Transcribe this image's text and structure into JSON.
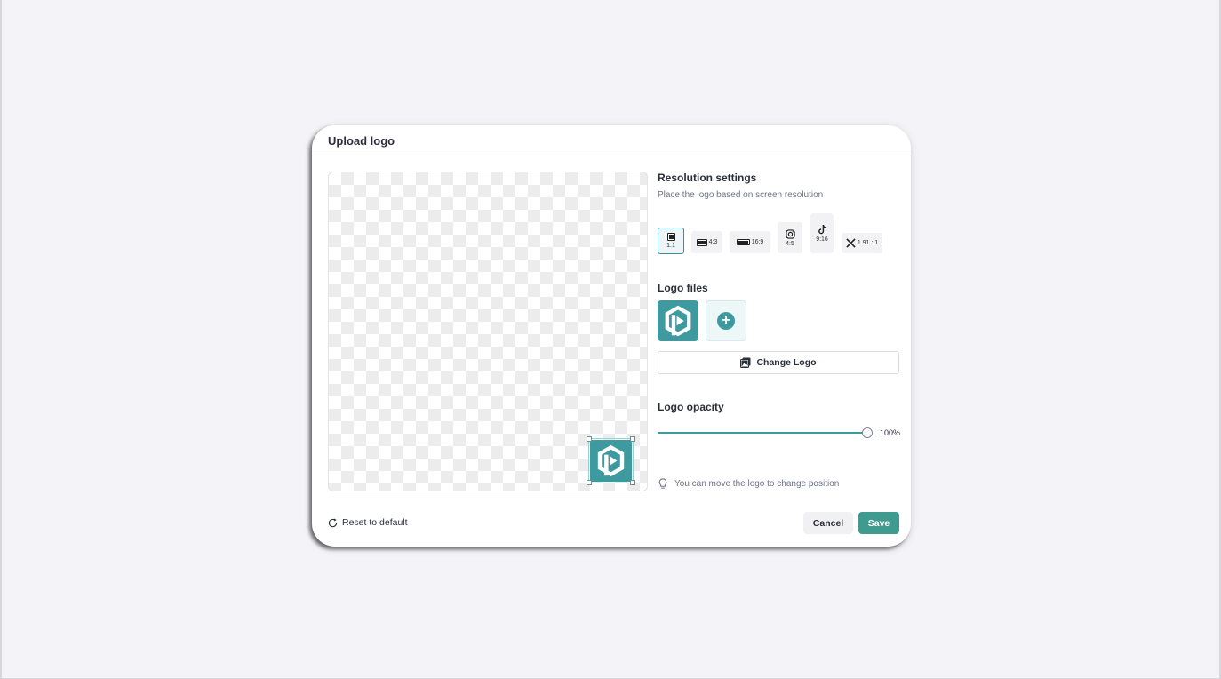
{
  "modal": {
    "title": "Upload logo"
  },
  "resolution": {
    "title": "Resolution settings",
    "subtitle": "Place the logo based on screen resolution",
    "options": [
      {
        "label": "1:1",
        "icon": "square-icon",
        "selected": true
      },
      {
        "label": "4:3",
        "icon": "landscape-icon",
        "selected": false
      },
      {
        "label": "16:9",
        "icon": "widescreen-icon",
        "selected": false
      },
      {
        "label": "4:5",
        "icon": "instagram-icon",
        "selected": false
      },
      {
        "label": "9:16",
        "icon": "tiktok-icon",
        "selected": false
      },
      {
        "label": "1.91 : 1",
        "icon": "x-twitter-icon",
        "selected": false
      }
    ]
  },
  "logo_files": {
    "title": "Logo files",
    "change_label": "Change Logo",
    "add_icon": "plus-icon"
  },
  "opacity": {
    "title": "Logo opacity",
    "value": 1.0,
    "value_label": "100%"
  },
  "hint": "You can move the logo to change position",
  "footer": {
    "reset_label": "Reset to default",
    "cancel_label": "Cancel",
    "save_label": "Save"
  },
  "colors": {
    "accent": "#3f9a9f",
    "save_button": "#3f9a8f",
    "selected_border": "#3e8d9a"
  }
}
